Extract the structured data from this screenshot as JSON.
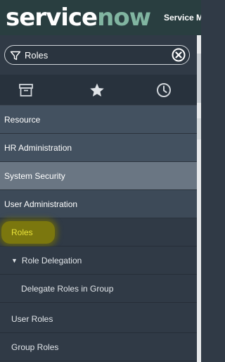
{
  "header": {
    "logo_part1": "service",
    "logo_part2": "now",
    "title": "Service Management"
  },
  "filter": {
    "value": "Roles"
  },
  "icons": {
    "filter": "filter-icon",
    "clear": "clear-circle-x-icon",
    "tab_all": "archive-box-icon",
    "tab_favorites": "star-icon",
    "tab_history": "clock-icon"
  },
  "colors": {
    "header_bg": "#293e40",
    "nav_bg": "#303a46",
    "highlight": "#827d0a",
    "active_text": "#e8e23a"
  },
  "nav": {
    "items": [
      {
        "label": "Resource"
      },
      {
        "label": "HR Administration"
      },
      {
        "label": "System Security"
      },
      {
        "label": "User Administration"
      },
      {
        "label": "Roles"
      },
      {
        "label": "Role Delegation",
        "expanded": true
      },
      {
        "label": "Delegate Roles in Group"
      },
      {
        "label": "User Roles"
      },
      {
        "label": "Group Roles"
      }
    ]
  }
}
